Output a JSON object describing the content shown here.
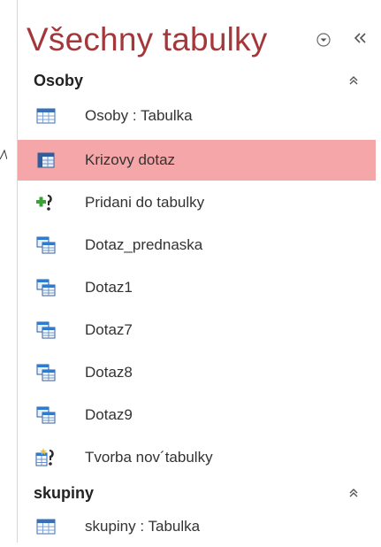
{
  "pane": {
    "title": "Všechny tabulky",
    "menu_icon": "circle-chevron-down-icon",
    "collapse_icon": "double-chevron-left-icon"
  },
  "groups": [
    {
      "name": "Osoby",
      "items": [
        {
          "label": "Osoby : Tabulka",
          "icon": "table-icon"
        },
        {
          "label": "Krizovy dotaz",
          "icon": "crosstab-query-icon",
          "selected": true
        },
        {
          "label": "Pridani do tabulky",
          "icon": "append-query-icon"
        },
        {
          "label": "Dotaz_prednaska",
          "icon": "select-query-icon"
        },
        {
          "label": "Dotaz1",
          "icon": "select-query-icon"
        },
        {
          "label": "Dotaz7",
          "icon": "select-query-icon"
        },
        {
          "label": "Dotaz8",
          "icon": "select-query-icon"
        },
        {
          "label": "Dotaz9",
          "icon": "select-query-icon"
        },
        {
          "label": "Tvorba nov´tabulky",
          "icon": "make-table-query-icon"
        }
      ]
    },
    {
      "name": "skupiny",
      "items": [
        {
          "label": "skupiny : Tabulka",
          "icon": "table-icon"
        }
      ]
    }
  ],
  "colors": {
    "title": "#a4373a",
    "selected_row": "#f4a6a8"
  }
}
